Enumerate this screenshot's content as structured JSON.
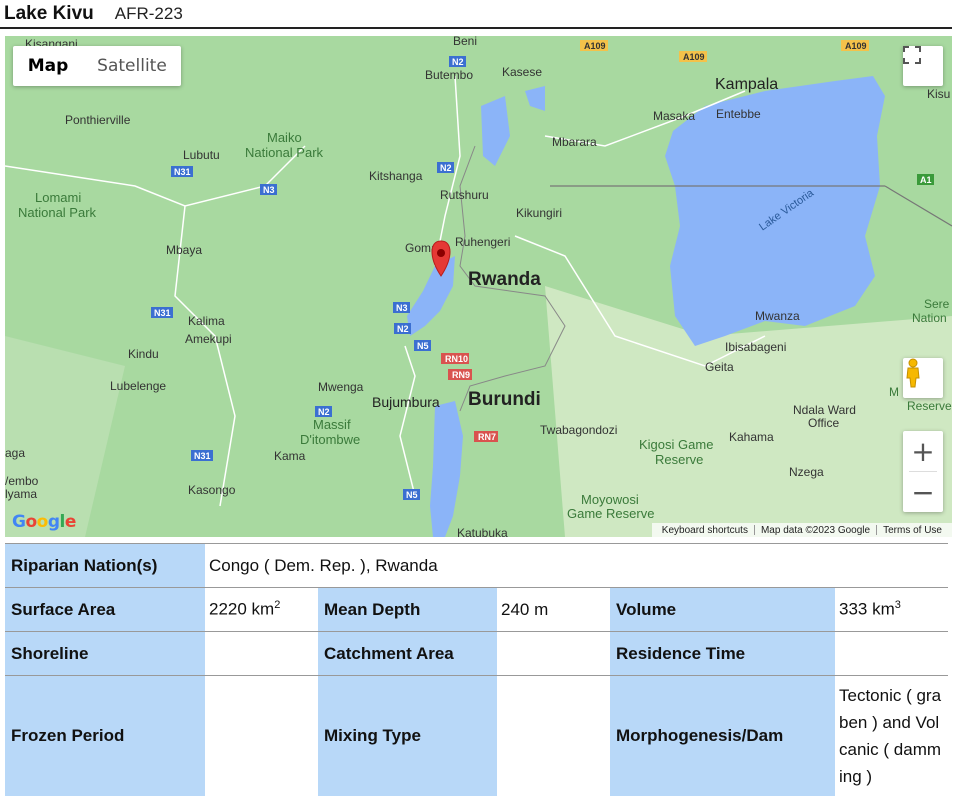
{
  "header": {
    "title": "Lake Kivu",
    "code": "AFR-223"
  },
  "map": {
    "type_map": "Map",
    "type_satellite": "Satellite",
    "google_logo": "Google",
    "keyboard_shortcuts": "Keyboard shortcuts",
    "map_data": "Map data ©2023 Google",
    "terms": "Terms of Use",
    "zoom_in": "+",
    "zoom_out": "−",
    "places": {
      "kisangani": "Kisangani",
      "beni": "Beni",
      "butembo": "Butembo",
      "kasese": "Kasese",
      "kampala": "Kampala",
      "entebbe": "Entebbe",
      "kisu": "Kisu",
      "masaka": "Masaka",
      "ponthierville": "Ponthierville",
      "maiko": "Maiko",
      "maiko2": "National Park",
      "lubutu": "Lubutu",
      "mbarara": "Mbarara",
      "lomami": "Lomami",
      "lomami2": "National Park",
      "kitshanga": "Kitshanga",
      "rutshuru": "Rutshuru",
      "kikungiri": "Kikungiri",
      "lake_victoria": "Lake Victoria",
      "goma": "Goma",
      "ruhengeri": "Ruhengeri",
      "rwanda": "Rwanda",
      "mbaya": "Mbaya",
      "kalima": "Kalima",
      "amekupi": "Amekupi",
      "mwanza": "Mwanza",
      "kindu": "Kindu",
      "ibisabageni": "Ibisabageni",
      "sere": "Sere",
      "sere2": "Nation",
      "lubelenge": "Lubelenge",
      "geita": "Geita",
      "mwenga": "Mwenga",
      "bujumbura": "Bujumbura",
      "burundi": "Burundi",
      "ndala": "Ndala Ward",
      "ndala2": "Office",
      "massif": "Massif",
      "massif2": "D'itombwe",
      "twabagondozi": "Twabagondozi",
      "kahama": "Kahama",
      "kigosi": "Kigosi Game",
      "kigosi2": "Reserve",
      "aga": "aga",
      "kama": "Kama",
      "nzega": "Nzega",
      "wembo": "/embo",
      "lyama": "lyama",
      "kasongo": "Kasongo",
      "moyowosi": "Moyowosi",
      "moyowosi2": "Game Reserve",
      "katubuka": "Katubuka",
      "mg": "M G",
      "reserve": "Reserve"
    },
    "roads": {
      "a109a": "A109",
      "a109b": "A109",
      "a109c": "A109",
      "n2a": "N2",
      "n2b": "N2",
      "n2c": "N2",
      "n2d": "N2",
      "n31a": "N31",
      "n31b": "N31",
      "n31c": "N31",
      "n3a": "N3",
      "n3b": "N3",
      "n5a": "N5",
      "n5b": "N5",
      "rn10": "RN10",
      "rn9": "RN9",
      "rn7": "RN7",
      "a1": "A1"
    }
  },
  "table": {
    "riparian_label": "Riparian Nation(s)",
    "riparian_value": "Congo ( Dem. Rep. ), Rwanda",
    "surface_label": "Surface Area",
    "surface_value": "2220 km",
    "surface_sup": "2",
    "depth_label": "Mean Depth",
    "depth_value": "240 m",
    "volume_label": "Volume",
    "volume_value": "333 km",
    "volume_sup": "3",
    "shoreline_label": "Shoreline",
    "shoreline_value": "",
    "catchment_label": "Catchment Area",
    "catchment_value": "",
    "residence_label": "Residence Time",
    "residence_value": "",
    "frozen_label": "Frozen Period",
    "frozen_value": "",
    "mixing_label": "Mixing Type",
    "mixing_value": "",
    "morph_label": "Morphogenesis/Dam",
    "morph_value": "Tectonic ( graben ) and Volcanic ( damming )"
  }
}
